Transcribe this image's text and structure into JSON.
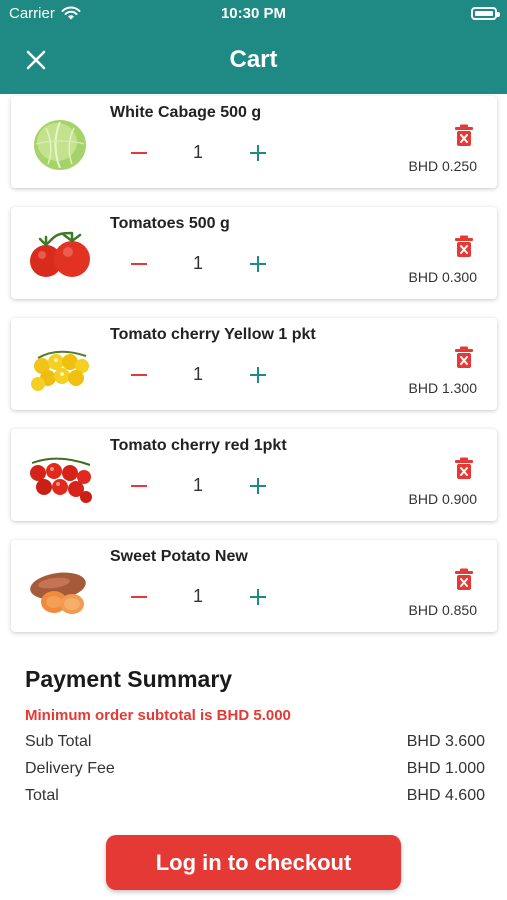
{
  "status_bar": {
    "carrier": "Carrier",
    "time": "10:30 PM"
  },
  "header": {
    "title": "Cart",
    "close_icon": "close-icon"
  },
  "colors": {
    "primary": "#1e8a83",
    "accent": "#e53935"
  },
  "cart": {
    "items": [
      {
        "name": "White Cabage 500 g",
        "quantity": "1",
        "price": "BHD 0.250",
        "image": "cabbage"
      },
      {
        "name": "Tomatoes 500 g",
        "quantity": "1",
        "price": "BHD 0.300",
        "image": "tomatoes"
      },
      {
        "name": "Tomato cherry Yellow 1 pkt",
        "quantity": "1",
        "price": "BHD 1.300",
        "image": "yellow-cherry-tomatoes"
      },
      {
        "name": "Tomato cherry red 1pkt",
        "quantity": "1",
        "price": "BHD 0.900",
        "image": "red-cherry-tomatoes"
      },
      {
        "name": "Sweet Potato New",
        "quantity": "1",
        "price": "BHD 0.850",
        "image": "sweet-potato"
      }
    ]
  },
  "summary": {
    "title": "Payment Summary",
    "min_order_notice": "Minimum order subtotal is BHD 5.000",
    "rows": [
      {
        "label": "Sub Total",
        "value": "BHD 3.600"
      },
      {
        "label": "Delivery Fee",
        "value": "BHD 1.000"
      },
      {
        "label": "Total",
        "value": "BHD 4.600"
      }
    ]
  },
  "checkout_button": {
    "label": "Log in to checkout"
  }
}
